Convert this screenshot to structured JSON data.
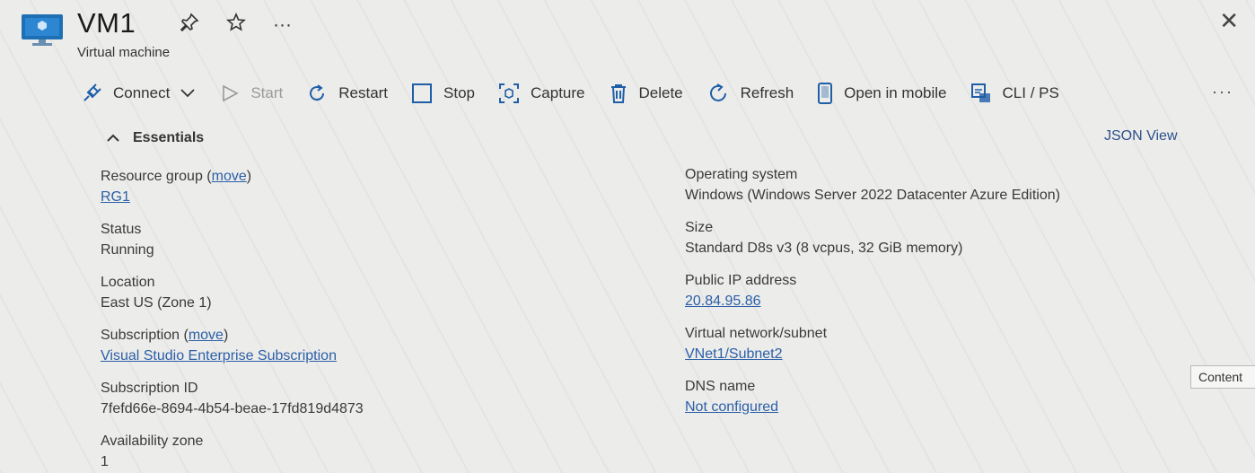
{
  "header": {
    "title": "VM1",
    "subtitle": "Virtual machine",
    "more_label": "···",
    "close_label": "✕"
  },
  "toolbar": {
    "connect": "Connect",
    "start": "Start",
    "restart": "Restart",
    "stop": "Stop",
    "capture": "Capture",
    "delete": "Delete",
    "refresh": "Refresh",
    "open_in_mobile": "Open in mobile",
    "cli_ps": "CLI / PS",
    "more": "···"
  },
  "essentials": {
    "label": "Essentials",
    "json_view": "JSON View"
  },
  "left_props": {
    "resource_group": {
      "label": "Resource group (",
      "move": "move",
      "close_paren": ")",
      "value": "RG1"
    },
    "status": {
      "label": "Status",
      "value": "Running"
    },
    "location": {
      "label": "Location",
      "value": "East US (Zone 1)"
    },
    "subscription": {
      "label": "Subscription (",
      "move": "move",
      "close_paren": ")",
      "value": "Visual Studio Enterprise Subscription"
    },
    "subscription_id": {
      "label": "Subscription ID",
      "value": "7fefd66e-8694-4b54-beae-17fd819d4873"
    },
    "availability_zone": {
      "label": "Availability zone",
      "value": "1"
    }
  },
  "right_props": {
    "os": {
      "label": "Operating system",
      "value": "Windows (Windows Server 2022 Datacenter Azure Edition)"
    },
    "size": {
      "label": "Size",
      "value": "Standard D8s v3 (8 vcpus, 32 GiB memory)"
    },
    "public_ip": {
      "label": "Public IP address",
      "value": "20.84.95.86"
    },
    "vnet": {
      "label": "Virtual network/subnet",
      "value": "VNet1/Subnet2"
    },
    "dns": {
      "label": "DNS name",
      "value": "Not configured"
    }
  },
  "side_tab": {
    "label": "Content"
  },
  "colors": {
    "link": "#2b5fa8",
    "brand_blue": "#1f6fb5",
    "disabled": "#9a9a9a"
  }
}
